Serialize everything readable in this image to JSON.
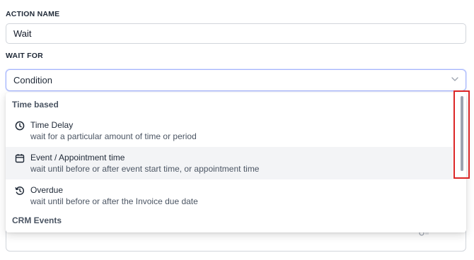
{
  "form": {
    "action_name_label": "ACTION NAME",
    "action_name_value": "Wait",
    "wait_for_label": "WAIT FOR",
    "wait_for_selected": "Condition"
  },
  "dropdown": {
    "groups": [
      {
        "header": "Time based",
        "options": [
          {
            "title": "Time Delay",
            "description": "wait for a particular amount of time or period",
            "icon": "clock-icon",
            "highlighted": false
          },
          {
            "title": "Event / Appointment time",
            "description": "wait until before or after event start time, or appointment time",
            "icon": "calendar-icon",
            "highlighted": true
          },
          {
            "title": "Overdue",
            "description": "wait until before or after the Invoice due date",
            "icon": "history-icon",
            "highlighted": false
          }
        ]
      },
      {
        "header": "CRM Events",
        "options": []
      }
    ]
  },
  "colors": {
    "highlight_border": "#dc2626",
    "select_focus_border": "#a5b4fc",
    "option_hover_bg": "#f3f4f6"
  }
}
